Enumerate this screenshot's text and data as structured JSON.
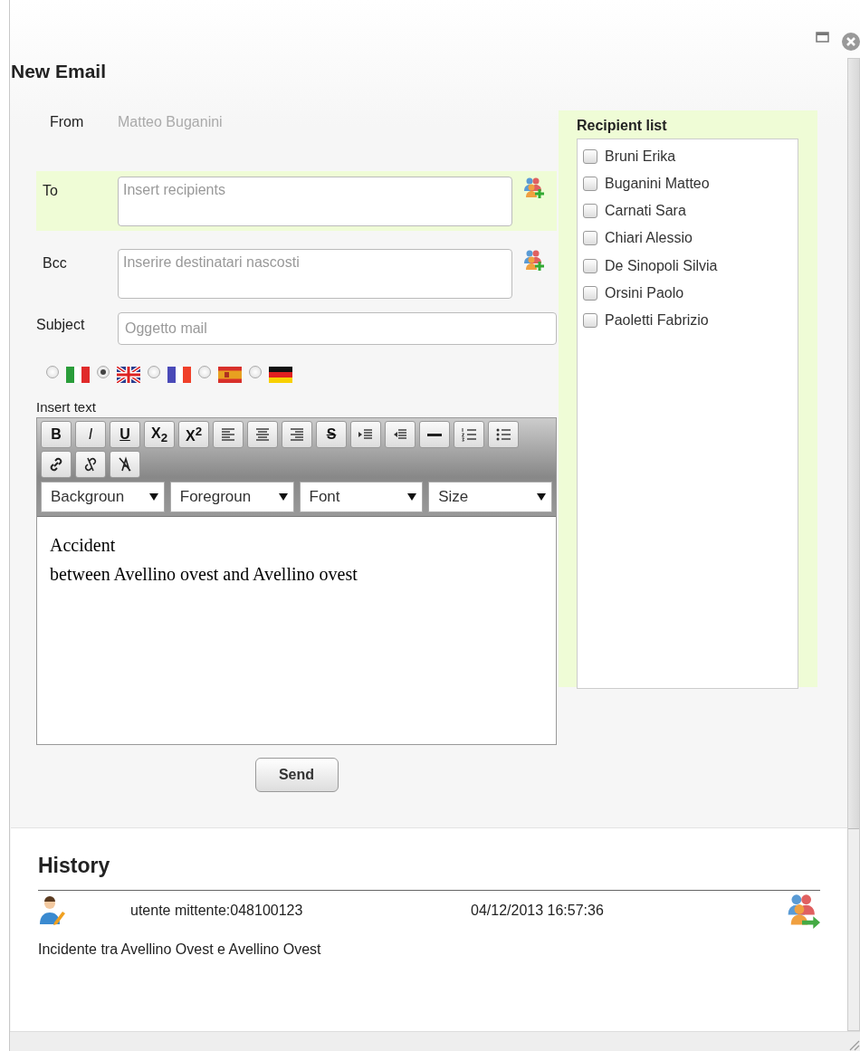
{
  "window": {
    "title": "New Email"
  },
  "from": {
    "label": "From",
    "value": "Matteo Buganini"
  },
  "to": {
    "label": "To",
    "placeholder": "Insert recipients",
    "highlighted": true
  },
  "bcc": {
    "label": "Bcc",
    "placeholder": "Inserire destinatari nascosti",
    "highlighted": false
  },
  "subject": {
    "label": "Subject",
    "placeholder": "Oggetto mail"
  },
  "languages": [
    {
      "kind": "italian",
      "selected": false
    },
    {
      "kind": "english",
      "selected": true
    },
    {
      "kind": "french",
      "selected": false
    },
    {
      "kind": "spanish",
      "selected": false
    },
    {
      "kind": "german",
      "selected": false
    }
  ],
  "editor": {
    "label": "Insert text",
    "toolbar_rows": [
      [
        {
          "kind": "bold",
          "label": "B"
        },
        {
          "kind": "italic",
          "label": "I"
        },
        {
          "kind": "underline",
          "label": "U"
        },
        {
          "kind": "subscript",
          "label": "X$_{2}$"
        },
        {
          "kind": "superscript",
          "label": "X$^{2}$"
        },
        {
          "kind": "align-left"
        },
        {
          "kind": "align-center"
        },
        {
          "kind": "align-right"
        },
        {
          "kind": "strikethrough",
          "label": "S"
        },
        {
          "kind": "indent"
        },
        {
          "kind": "outdent"
        },
        {
          "kind": "rule"
        },
        {
          "kind": "ordered-list"
        },
        {
          "kind": "bullet-list"
        }
      ],
      [
        {
          "kind": "link"
        },
        {
          "kind": "unlink"
        },
        {
          "kind": "clear-format"
        }
      ]
    ],
    "selects": [
      {
        "label": "Backgroun"
      },
      {
        "label": "Foregroun"
      },
      {
        "label": "Font"
      },
      {
        "label": "Size"
      }
    ],
    "lines": [
      "Accident",
      "between Avellino ovest and Avellino ovest"
    ]
  },
  "send_button": "Send",
  "recipient_list": {
    "title": "Recipient list",
    "items": [
      {
        "name": "Bruni Erika",
        "checked": false
      },
      {
        "name": "Buganini Matteo",
        "checked": false
      },
      {
        "name": "Carnati Sara",
        "checked": false
      },
      {
        "name": "Chiari Alessio",
        "checked": false
      },
      {
        "name": "De Sinopoli Silvia",
        "checked": false
      },
      {
        "name": "Orsini Paolo",
        "checked": false
      },
      {
        "name": "Paoletti Fabrizio",
        "checked": false
      }
    ]
  },
  "history": {
    "title": "History",
    "entries": [
      {
        "sender": "utente mittente:048100123",
        "time": "04/12/2013 16:57:36",
        "message": "Incidente tra Avellino Ovest e Avellino Ovest"
      }
    ]
  }
}
